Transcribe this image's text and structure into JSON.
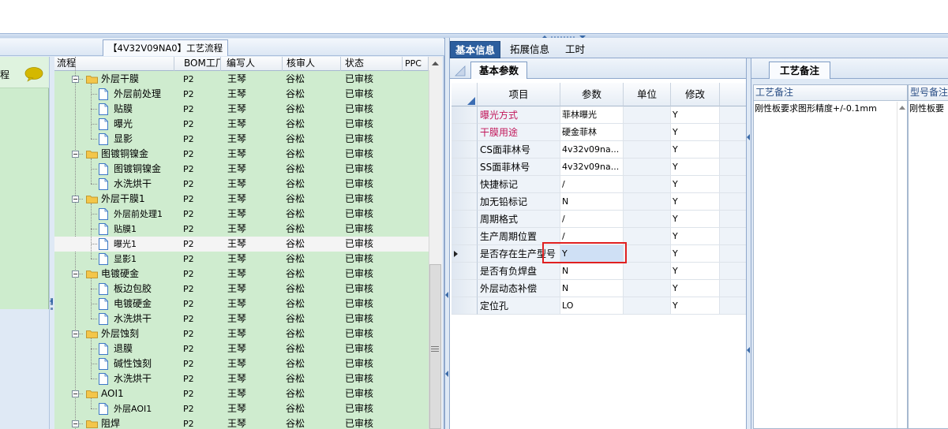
{
  "left_panel": {
    "title": "【4V32V09NA0】工艺流程",
    "side_label": "程",
    "columns": [
      "流程",
      "BOM工厂",
      "编写人",
      "核审人",
      "状态",
      "PPC"
    ],
    "rows": [
      {
        "level": 0,
        "type": "folder",
        "name": "外层干膜",
        "bom": "P2",
        "writer": "王琴",
        "reviewer": "谷松",
        "status": "已审核"
      },
      {
        "level": 1,
        "type": "doc",
        "name": "外层前处理",
        "bom": "P2",
        "writer": "王琴",
        "reviewer": "谷松",
        "status": "已审核"
      },
      {
        "level": 1,
        "type": "doc",
        "name": "贴膜",
        "bom": "P2",
        "writer": "王琴",
        "reviewer": "谷松",
        "status": "已审核"
      },
      {
        "level": 1,
        "type": "doc",
        "name": "曝光",
        "bom": "P2",
        "writer": "王琴",
        "reviewer": "谷松",
        "status": "已审核"
      },
      {
        "level": 1,
        "type": "doc",
        "name": "显影",
        "bom": "P2",
        "writer": "王琴",
        "reviewer": "谷松",
        "status": "已审核"
      },
      {
        "level": 0,
        "type": "folder",
        "name": "图镀铜镍金",
        "bom": "P2",
        "writer": "王琴",
        "reviewer": "谷松",
        "status": "已审核"
      },
      {
        "level": 1,
        "type": "doc",
        "name": "图镀铜镍金",
        "bom": "P2",
        "writer": "王琴",
        "reviewer": "谷松",
        "status": "已审核"
      },
      {
        "level": 1,
        "type": "doc",
        "name": "水洗烘干",
        "bom": "P2",
        "writer": "王琴",
        "reviewer": "谷松",
        "status": "已审核"
      },
      {
        "level": 0,
        "type": "folder",
        "name": "外层干膜1",
        "bom": "P2",
        "writer": "王琴",
        "reviewer": "谷松",
        "status": "已审核"
      },
      {
        "level": 1,
        "type": "doc",
        "name": "外层前处理1",
        "bom": "P2",
        "writer": "王琴",
        "reviewer": "谷松",
        "status": "已审核"
      },
      {
        "level": 1,
        "type": "doc",
        "name": "贴膜1",
        "bom": "P2",
        "writer": "王琴",
        "reviewer": "谷松",
        "status": "已审核"
      },
      {
        "level": 1,
        "type": "doc",
        "name": "曝光1",
        "bom": "P2",
        "writer": "王琴",
        "reviewer": "谷松",
        "status": "已审核",
        "selected": true
      },
      {
        "level": 1,
        "type": "doc",
        "name": "显影1",
        "bom": "P2",
        "writer": "王琴",
        "reviewer": "谷松",
        "status": "已审核"
      },
      {
        "level": 0,
        "type": "folder",
        "name": "电镀硬金",
        "bom": "P2",
        "writer": "王琴",
        "reviewer": "谷松",
        "status": "已审核"
      },
      {
        "level": 1,
        "type": "doc",
        "name": "板边包胶",
        "bom": "P2",
        "writer": "王琴",
        "reviewer": "谷松",
        "status": "已审核"
      },
      {
        "level": 1,
        "type": "doc",
        "name": "电镀硬金",
        "bom": "P2",
        "writer": "王琴",
        "reviewer": "谷松",
        "status": "已审核"
      },
      {
        "level": 1,
        "type": "doc",
        "name": "水洗烘干",
        "bom": "P2",
        "writer": "王琴",
        "reviewer": "谷松",
        "status": "已审核"
      },
      {
        "level": 0,
        "type": "folder",
        "name": "外层蚀刻",
        "bom": "P2",
        "writer": "王琴",
        "reviewer": "谷松",
        "status": "已审核"
      },
      {
        "level": 1,
        "type": "doc",
        "name": "退膜",
        "bom": "P2",
        "writer": "王琴",
        "reviewer": "谷松",
        "status": "已审核"
      },
      {
        "level": 1,
        "type": "doc",
        "name": "碱性蚀刻",
        "bom": "P2",
        "writer": "王琴",
        "reviewer": "谷松",
        "status": "已审核"
      },
      {
        "level": 1,
        "type": "doc",
        "name": "水洗烘干",
        "bom": "P2",
        "writer": "王琴",
        "reviewer": "谷松",
        "status": "已审核"
      },
      {
        "level": 0,
        "type": "folder",
        "name": "AOI1",
        "bom": "P2",
        "writer": "王琴",
        "reviewer": "谷松",
        "status": "已审核"
      },
      {
        "level": 1,
        "type": "doc",
        "name": "外层AOI1",
        "bom": "P2",
        "writer": "王琴",
        "reviewer": "谷松",
        "status": "已审核"
      },
      {
        "level": 0,
        "type": "folder",
        "name": "阻焊",
        "bom": "P2",
        "writer": "王琴",
        "reviewer": "谷松",
        "status": "已审核"
      }
    ]
  },
  "right_tabs": [
    "基本信息",
    "拓展信息",
    "工时"
  ],
  "basic_params": {
    "tab": "基本参数",
    "columns": [
      "项目",
      "参数",
      "单位",
      "修改"
    ],
    "rows": [
      {
        "item": "曝光方式",
        "param": "菲林曝光",
        "unit": "",
        "mod": "Y",
        "highlight": true
      },
      {
        "item": "干膜用途",
        "param": "硬金菲林",
        "unit": "",
        "mod": "Y",
        "highlight": true
      },
      {
        "item": "CS面菲林号",
        "param": "4v32v09na...",
        "unit": "",
        "mod": "Y"
      },
      {
        "item": "SS面菲林号",
        "param": "4v32v09na...",
        "unit": "",
        "mod": "Y"
      },
      {
        "item": "快捷标记",
        "param": "/",
        "unit": "",
        "mod": "Y"
      },
      {
        "item": "加无铅标记",
        "param": "N",
        "unit": "",
        "mod": "Y"
      },
      {
        "item": "周期格式",
        "param": "/",
        "unit": "",
        "mod": "Y"
      },
      {
        "item": "生产周期位置",
        "param": "/",
        "unit": "",
        "mod": "Y"
      },
      {
        "item": "是否存在生产型号",
        "param": "Y",
        "unit": "",
        "mod": "Y",
        "current": true
      },
      {
        "item": "是否有负焊盘",
        "param": "N",
        "unit": "",
        "mod": "Y"
      },
      {
        "item": "外层动态补偿",
        "param": "N",
        "unit": "",
        "mod": "Y"
      },
      {
        "item": "定位孔",
        "param": "LO",
        "unit": "",
        "mod": "Y"
      }
    ]
  },
  "process_note": {
    "tab": "工艺备注",
    "col1_header": "工艺备注",
    "col1_text": "刚性板要求图形精度+/-0.1mm",
    "col2_header": "型号备注",
    "col2_text": "刚性板要"
  },
  "colors": {
    "accent": "#2c5e9e",
    "tree_bg": "#cfeccf",
    "highlight_text": "#c2185b",
    "annotation_box": "#e02020"
  }
}
